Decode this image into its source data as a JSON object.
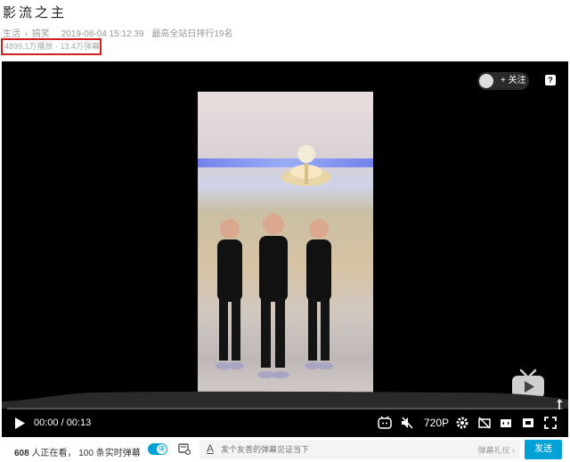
{
  "video": {
    "title": "影流之主",
    "breadcrumb": [
      "生活",
      "搞笑"
    ],
    "breadcrumb_sep": "›",
    "published": "2019-08-04 15:12:39",
    "rank": "最高全站日排行19名",
    "stats": "4899.1万播放 · 13.4万弹幕"
  },
  "player": {
    "follow_label": "+ 关注",
    "help_label": "?",
    "time_current": "00:00",
    "time_sep": "/",
    "time_total": "00:13",
    "quality": "720P",
    "progress": 0
  },
  "bottom": {
    "viewers_count": "608",
    "viewers_text": "人正在看，",
    "danmaku_count": "100",
    "danmaku_text": "条实时弹幕",
    "toggle_label": "弹",
    "input_placeholder": "发个友善的弹幕见证当下",
    "etiquette": "弹幕礼仪 ›",
    "send_label": "发送"
  },
  "colors": {
    "accent": "#00a1d6",
    "highlight_box": "#d41f1f"
  }
}
